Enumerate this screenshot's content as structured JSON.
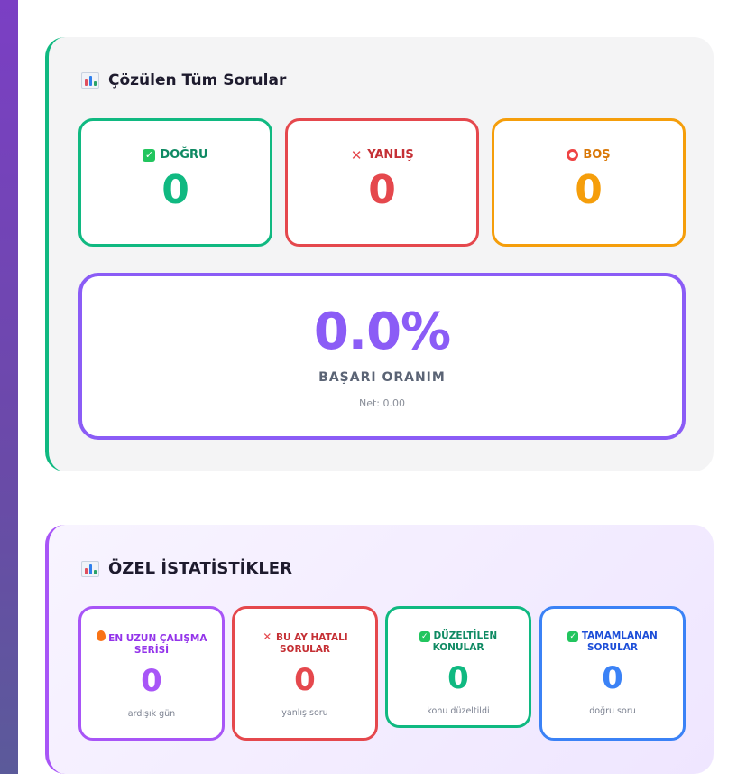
{
  "colors": {
    "green": "#10b981",
    "red": "#e5484d",
    "orange": "#f59e0b",
    "purple": "#8b5cf6",
    "blue": "#3b82f6"
  },
  "solved": {
    "title": "Çözülen Tüm Sorular",
    "icon": "bar-chart-icon",
    "correct": {
      "icon": "check-icon",
      "label": "DOĞRU",
      "value": "0"
    },
    "wrong": {
      "icon": "cross-icon",
      "label": "YANLIŞ",
      "value": "0"
    },
    "empty": {
      "icon": "circle-icon",
      "label": "BOŞ",
      "value": "0"
    },
    "success_rate": {
      "value": "0.0%",
      "label": "BAŞARI ORANIM",
      "net": "Net: 0.00"
    }
  },
  "special": {
    "title": "ÖZEL İSTATİSTİKLER",
    "icon": "bar-chart-icon",
    "cards": [
      {
        "icon": "fire-icon",
        "label": "EN UZUN ÇALIŞMA SERİSİ",
        "value": "0",
        "sub": "ardışık gün"
      },
      {
        "icon": "cross-icon",
        "label": "BU AY HATALI SORULAR",
        "value": "0",
        "sub": "yanlış soru"
      },
      {
        "icon": "check-icon",
        "label": "DÜZELTİLEN KONULAR",
        "value": "0",
        "sub": "konu düzeltildi"
      },
      {
        "icon": "check-icon",
        "label": "TAMAMLANAN SORULAR",
        "value": "0",
        "sub": "doğru soru"
      }
    ]
  }
}
